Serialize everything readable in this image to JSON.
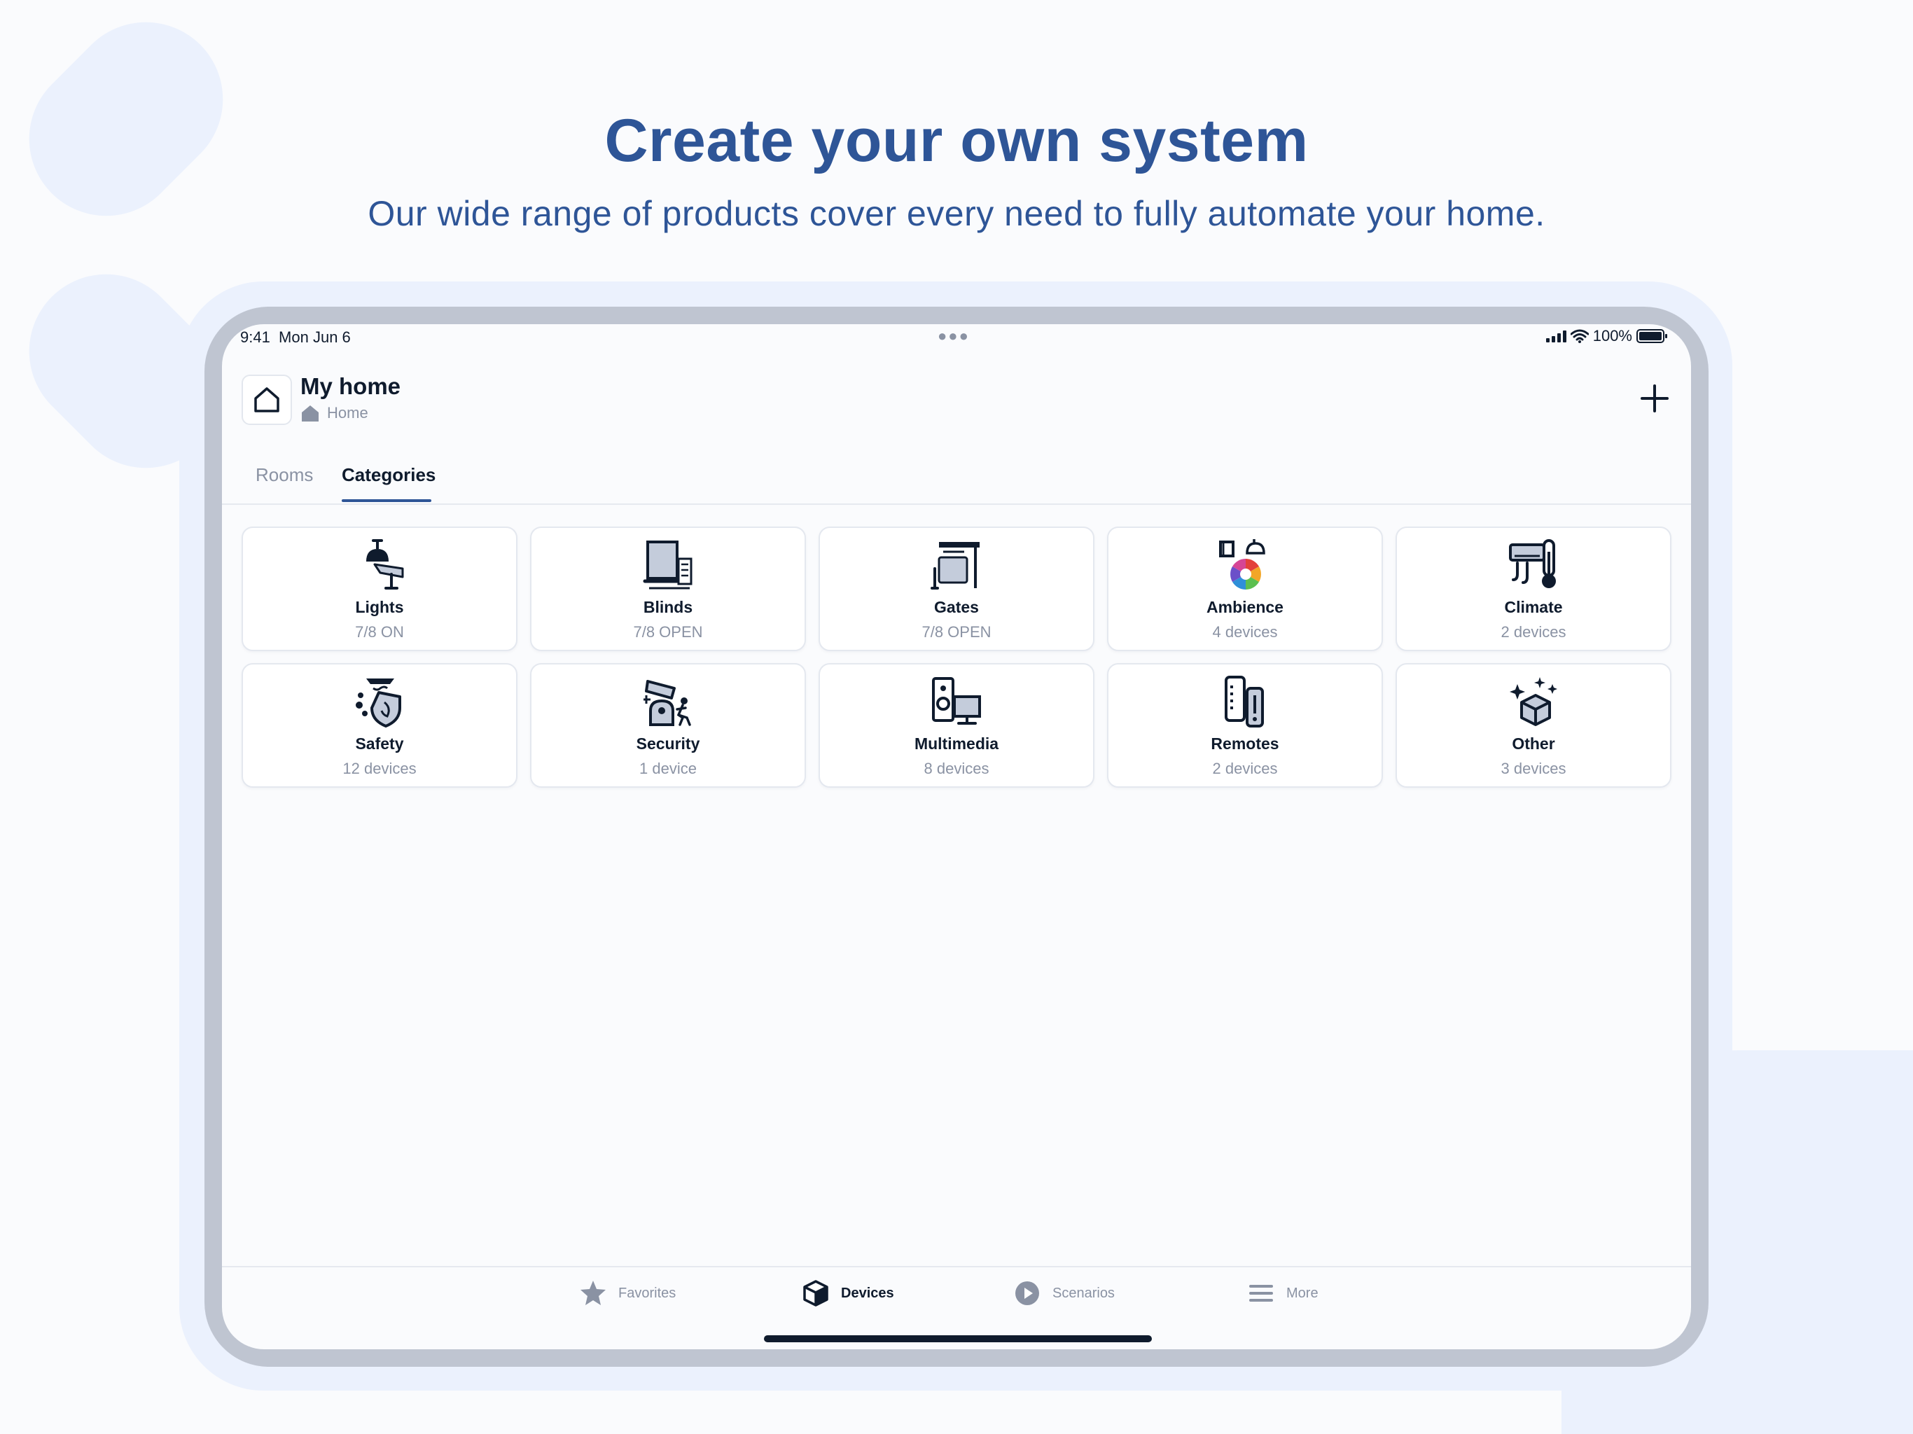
{
  "marketing": {
    "headline": "Create your own system",
    "subline": "Our wide range of products cover every need to fully automate your home."
  },
  "status_bar": {
    "time_date": "9:41  Mon Jun 6",
    "battery": "100%"
  },
  "header": {
    "title": "My home",
    "subtitle": "Home",
    "home_icon": "house-outline-icon",
    "add_icon": "plus-icon"
  },
  "tabs": {
    "rooms": "Rooms",
    "categories": "Categories",
    "active": "Categories"
  },
  "categories": [
    {
      "name": "Lights",
      "status": "7/8 ON",
      "icon": "ceiling-lamp-icon"
    },
    {
      "name": "Blinds",
      "status": "7/8 OPEN",
      "icon": "blinds-icon"
    },
    {
      "name": "Gates",
      "status": "7/8 OPEN",
      "icon": "gate-icon"
    },
    {
      "name": "Ambience",
      "status": "4 devices",
      "icon": "ambience-color-icon"
    },
    {
      "name": "Climate",
      "status": "2 devices",
      "icon": "thermometer-ac-icon"
    },
    {
      "name": "Safety",
      "status": "12 devices",
      "icon": "shield-flame-icon"
    },
    {
      "name": "Security",
      "status": "1 device",
      "icon": "camera-alarm-icon"
    },
    {
      "name": "Multimedia",
      "status": "8 devices",
      "icon": "speaker-tv-icon"
    },
    {
      "name": "Remotes",
      "status": "2 devices",
      "icon": "remote-control-icon"
    },
    {
      "name": "Other",
      "status": "3 devices",
      "icon": "sparkle-box-icon"
    }
  ],
  "bottom_nav": [
    {
      "label": "Favorites",
      "icon": "star-icon",
      "active": false
    },
    {
      "label": "Devices",
      "icon": "cube-icon",
      "active": true
    },
    {
      "label": "Scenarios",
      "icon": "play-circle-icon",
      "active": false
    },
    {
      "label": "More",
      "icon": "menu-lines-icon",
      "active": false
    }
  ],
  "colors": {
    "brand_blue": "#2e5597",
    "text_dark": "#0f1b2d",
    "text_muted": "#8a92a3",
    "background": "#fafbfd",
    "blob": "#ebf1fd",
    "device_frame": "#bfc5d1"
  }
}
